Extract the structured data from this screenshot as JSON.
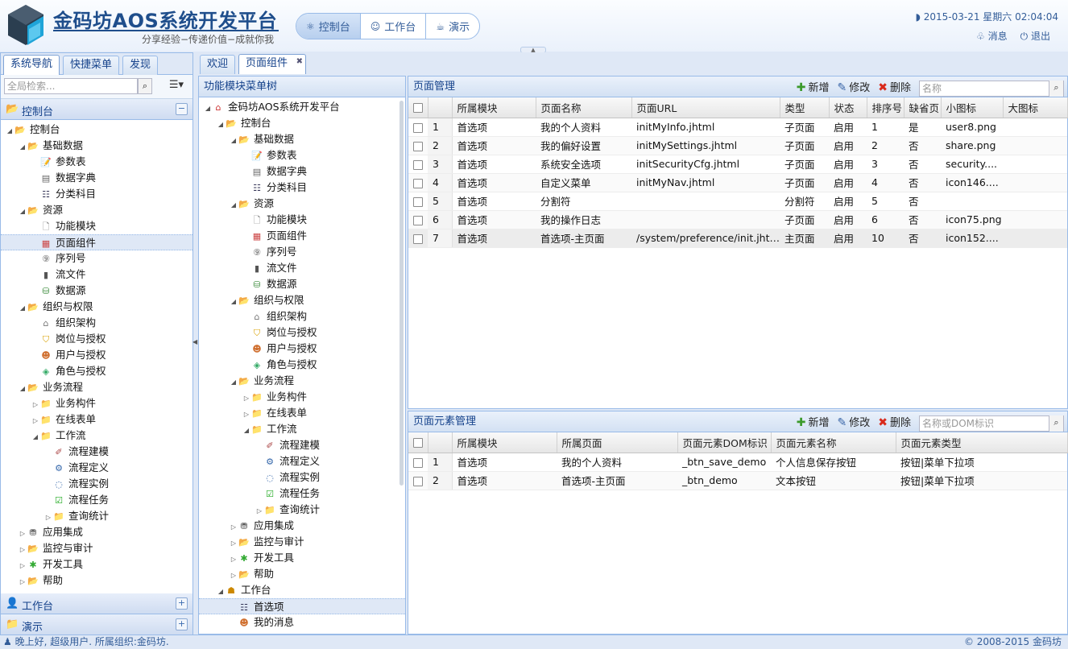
{
  "header": {
    "title": "金码坊AOS系统开发平台",
    "slogan": "分享经验−传递价值−成就你我",
    "nav": [
      {
        "label": "控制台",
        "icon": "sitemap-icon"
      },
      {
        "label": "工作台",
        "icon": "workbench-icon"
      },
      {
        "label": "演示",
        "icon": "demo-icon"
      }
    ],
    "datetime": "2015-03-21 星期六 02:04:04",
    "messages_label": "消息",
    "logout_label": "退出"
  },
  "left": {
    "tabs": [
      "系统导航",
      "快捷菜单",
      "发现"
    ],
    "search_placeholder": "全局检索...",
    "sections": [
      {
        "label": "控制台",
        "tool": "−"
      },
      {
        "label": "工作台",
        "tool": "+"
      },
      {
        "label": "演示",
        "tool": "+"
      }
    ],
    "tree": [
      {
        "label": "控制台",
        "level": 0,
        "toggle": "open",
        "icon": "folder-open"
      },
      {
        "label": "基础数据",
        "level": 1,
        "toggle": "open",
        "icon": "folder-open"
      },
      {
        "label": "参数表",
        "level": 2,
        "toggle": "",
        "icon": "param"
      },
      {
        "label": "数据字典",
        "level": 2,
        "toggle": "",
        "icon": "dict"
      },
      {
        "label": "分类科目",
        "level": 2,
        "toggle": "",
        "icon": "list"
      },
      {
        "label": "资源",
        "level": 1,
        "toggle": "open",
        "icon": "folder-open"
      },
      {
        "label": "功能模块",
        "level": 2,
        "toggle": "",
        "icon": "page"
      },
      {
        "label": "页面组件",
        "level": 2,
        "toggle": "",
        "icon": "component",
        "selected": true
      },
      {
        "label": "序列号",
        "level": 2,
        "toggle": "",
        "icon": "seq"
      },
      {
        "label": "流文件",
        "level": 2,
        "toggle": "",
        "icon": "file"
      },
      {
        "label": "数据源",
        "level": 2,
        "toggle": "",
        "icon": "db"
      },
      {
        "label": "组织与权限",
        "level": 1,
        "toggle": "open",
        "icon": "folder-open"
      },
      {
        "label": "组织架构",
        "level": 2,
        "toggle": "",
        "icon": "org"
      },
      {
        "label": "岗位与授权",
        "level": 2,
        "toggle": "",
        "icon": "shield"
      },
      {
        "label": "用户与授权",
        "level": 2,
        "toggle": "",
        "icon": "user"
      },
      {
        "label": "角色与授权",
        "level": 2,
        "toggle": "",
        "icon": "role"
      },
      {
        "label": "业务流程",
        "level": 1,
        "toggle": "open",
        "icon": "folder-open"
      },
      {
        "label": "业务构件",
        "level": 2,
        "toggle": "closed",
        "icon": "folder"
      },
      {
        "label": "在线表单",
        "level": 2,
        "toggle": "closed",
        "icon": "folder"
      },
      {
        "label": "工作流",
        "level": 2,
        "toggle": "open",
        "icon": "folder"
      },
      {
        "label": "流程建模",
        "level": 3,
        "toggle": "",
        "icon": "tool"
      },
      {
        "label": "流程定义",
        "level": 3,
        "toggle": "",
        "icon": "flow"
      },
      {
        "label": "流程实例",
        "level": 3,
        "toggle": "",
        "icon": "instance"
      },
      {
        "label": "流程任务",
        "level": 3,
        "toggle": "",
        "icon": "task"
      },
      {
        "label": "查询统计",
        "level": 3,
        "toggle": "closed",
        "icon": "folder"
      },
      {
        "label": "应用集成",
        "level": 1,
        "toggle": "closed",
        "icon": "integration"
      },
      {
        "label": "监控与审计",
        "level": 1,
        "toggle": "closed",
        "icon": "folder-open"
      },
      {
        "label": "开发工具",
        "level": 1,
        "toggle": "closed",
        "icon": "devtools"
      },
      {
        "label": "帮助",
        "level": 1,
        "toggle": "closed",
        "icon": "folder-open"
      }
    ]
  },
  "mid": {
    "tabs": [
      "欢迎",
      "页面组件"
    ],
    "panel_title": "功能模块菜单树",
    "tree": [
      {
        "label": "金码坊AOS系统开发平台",
        "level": 0,
        "toggle": "open",
        "icon": "home"
      },
      {
        "label": "控制台",
        "level": 1,
        "toggle": "open",
        "icon": "folder-open"
      },
      {
        "label": "基础数据",
        "level": 2,
        "toggle": "open",
        "icon": "folder-open"
      },
      {
        "label": "参数表",
        "level": 3,
        "toggle": "",
        "icon": "param"
      },
      {
        "label": "数据字典",
        "level": 3,
        "toggle": "",
        "icon": "dict"
      },
      {
        "label": "分类科目",
        "level": 3,
        "toggle": "",
        "icon": "list"
      },
      {
        "label": "资源",
        "level": 2,
        "toggle": "open",
        "icon": "folder-open"
      },
      {
        "label": "功能模块",
        "level": 3,
        "toggle": "",
        "icon": "page"
      },
      {
        "label": "页面组件",
        "level": 3,
        "toggle": "",
        "icon": "component"
      },
      {
        "label": "序列号",
        "level": 3,
        "toggle": "",
        "icon": "seq"
      },
      {
        "label": "流文件",
        "level": 3,
        "toggle": "",
        "icon": "file"
      },
      {
        "label": "数据源",
        "level": 3,
        "toggle": "",
        "icon": "db"
      },
      {
        "label": "组织与权限",
        "level": 2,
        "toggle": "open",
        "icon": "folder-open"
      },
      {
        "label": "组织架构",
        "level": 3,
        "toggle": "",
        "icon": "org"
      },
      {
        "label": "岗位与授权",
        "level": 3,
        "toggle": "",
        "icon": "shield"
      },
      {
        "label": "用户与授权",
        "level": 3,
        "toggle": "",
        "icon": "user"
      },
      {
        "label": "角色与授权",
        "level": 3,
        "toggle": "",
        "icon": "role"
      },
      {
        "label": "业务流程",
        "level": 2,
        "toggle": "open",
        "icon": "folder-open"
      },
      {
        "label": "业务构件",
        "level": 3,
        "toggle": "closed",
        "icon": "folder"
      },
      {
        "label": "在线表单",
        "level": 3,
        "toggle": "closed",
        "icon": "folder"
      },
      {
        "label": "工作流",
        "level": 3,
        "toggle": "open",
        "icon": "folder"
      },
      {
        "label": "流程建模",
        "level": 4,
        "toggle": "",
        "icon": "tool"
      },
      {
        "label": "流程定义",
        "level": 4,
        "toggle": "",
        "icon": "flow"
      },
      {
        "label": "流程实例",
        "level": 4,
        "toggle": "",
        "icon": "instance"
      },
      {
        "label": "流程任务",
        "level": 4,
        "toggle": "",
        "icon": "task"
      },
      {
        "label": "查询统计",
        "level": 4,
        "toggle": "closed",
        "icon": "folder"
      },
      {
        "label": "应用集成",
        "level": 2,
        "toggle": "closed",
        "icon": "integration"
      },
      {
        "label": "监控与审计",
        "level": 2,
        "toggle": "closed",
        "icon": "folder-open"
      },
      {
        "label": "开发工具",
        "level": 2,
        "toggle": "closed",
        "icon": "devtools"
      },
      {
        "label": "帮助",
        "level": 2,
        "toggle": "closed",
        "icon": "folder-open"
      },
      {
        "label": "工作台",
        "level": 1,
        "toggle": "open",
        "icon": "workbench"
      },
      {
        "label": "首选项",
        "level": 2,
        "toggle": "",
        "icon": "list",
        "selected": true
      },
      {
        "label": "我的消息",
        "level": 2,
        "toggle": "",
        "icon": "user"
      }
    ]
  },
  "grid1": {
    "title": "页面管理",
    "add": "新增",
    "edit": "修改",
    "delete": "删除",
    "search_placeholder": "名称",
    "columns": [
      "所属模块",
      "页面名称",
      "页面URL",
      "类型",
      "状态",
      "排序号",
      "缺省页",
      "小图标",
      "大图标"
    ],
    "rows": [
      [
        "1",
        "首选项",
        "我的个人资料",
        "initMyInfo.jhtml",
        "子页面",
        "启用",
        "1",
        "是",
        "user8.png",
        ""
      ],
      [
        "2",
        "首选项",
        "我的偏好设置",
        "initMySettings.jhtml",
        "子页面",
        "启用",
        "2",
        "否",
        "share.png",
        ""
      ],
      [
        "3",
        "首选项",
        "系统安全选项",
        "initSecurityCfg.jhtml",
        "子页面",
        "启用",
        "3",
        "否",
        "security....",
        ""
      ],
      [
        "4",
        "首选项",
        "自定义菜单",
        "initMyNav.jhtml",
        "子页面",
        "启用",
        "4",
        "否",
        "icon146....",
        ""
      ],
      [
        "5",
        "首选项",
        "分割符",
        "",
        "分割符",
        "启用",
        "5",
        "否",
        "",
        ""
      ],
      [
        "6",
        "首选项",
        "我的操作日志",
        "",
        "子页面",
        "启用",
        "6",
        "否",
        "icon75.png",
        ""
      ],
      [
        "7",
        "首选项",
        "首选项-主页面",
        "/system/preference/init.jhtml",
        "主页面",
        "启用",
        "10",
        "否",
        "icon152....",
        ""
      ]
    ]
  },
  "grid2": {
    "title": "页面元素管理",
    "add": "新增",
    "edit": "修改",
    "delete": "删除",
    "search_placeholder": "名称或DOM标识",
    "columns": [
      "所属模块",
      "所属页面",
      "页面元素DOM标识",
      "页面元素名称",
      "页面元素类型"
    ],
    "rows": [
      [
        "1",
        "首选项",
        "我的个人资料",
        "_btn_save_demo",
        "个人信息保存按钮",
        "按钮|菜单下拉项"
      ],
      [
        "2",
        "首选项",
        "首选项-主页面",
        "_btn_demo",
        "文本按钮",
        "按钮|菜单下拉项"
      ]
    ]
  },
  "status": {
    "left": "晚上好, 超级用户. 所属组织:金码坊.",
    "right": "© 2008-2015 金码坊"
  }
}
